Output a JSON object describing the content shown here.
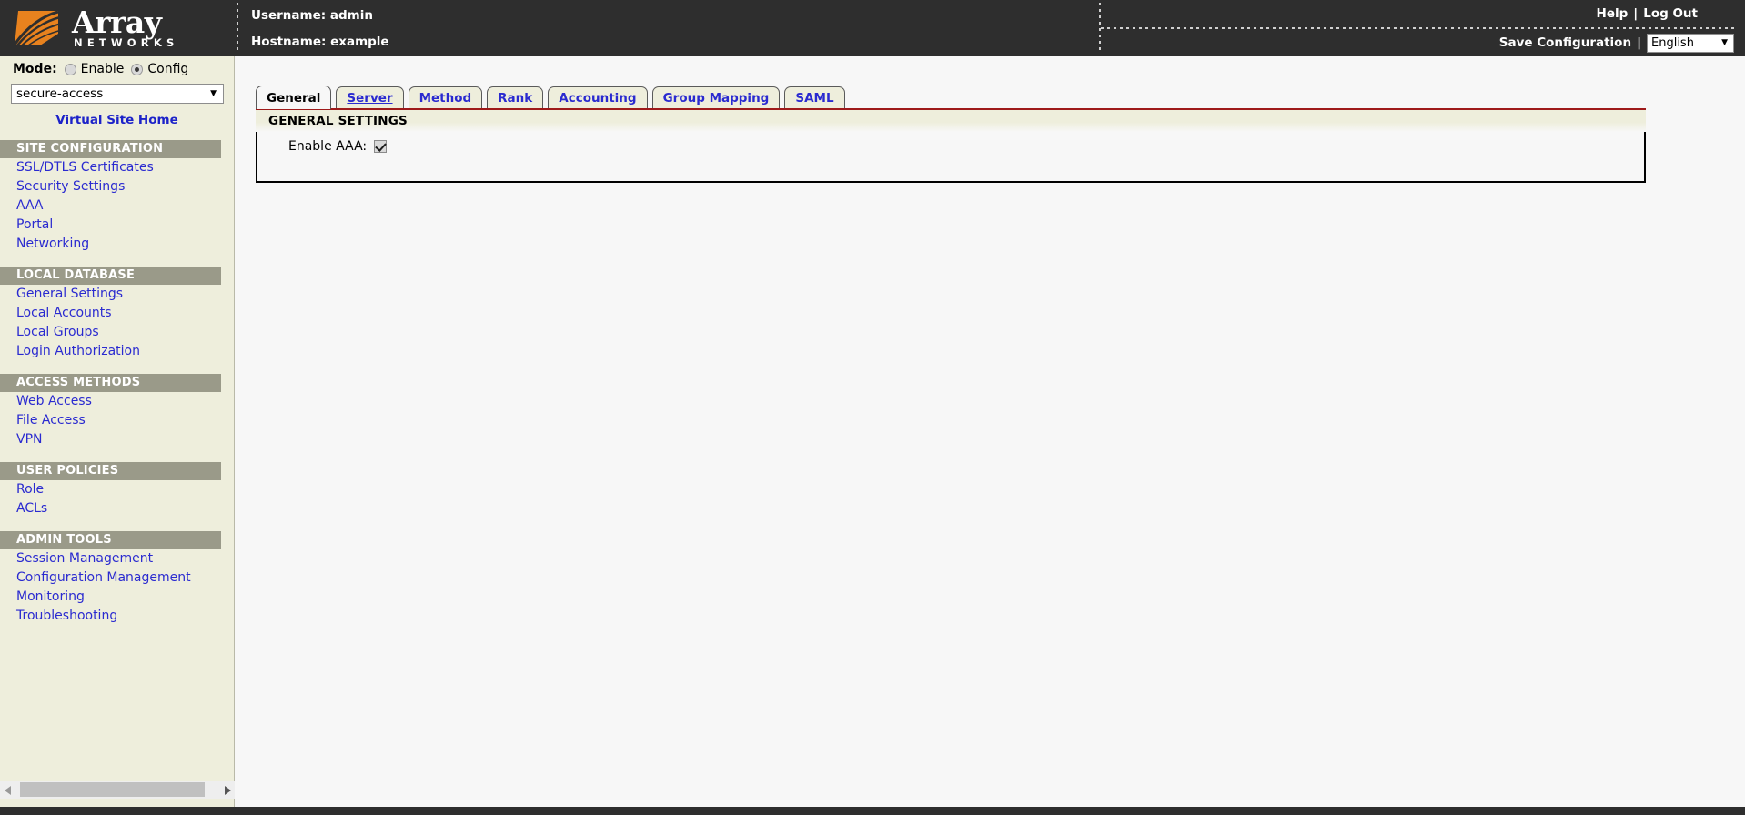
{
  "brand": {
    "name": "Array",
    "subtitle": "NETWORKS",
    "logo_icon": "array-networks-logo",
    "accent_color": "#E8821E",
    "header_bg": "#2E2E2E"
  },
  "header": {
    "username_line": "Username: admin",
    "hostname_line": "Hostname: example",
    "help_label": "Help",
    "separator": "|",
    "logout_label": "Log Out",
    "save_configuration_label": "Save Configuration",
    "language_value": "English",
    "language_options": [
      "English"
    ],
    "caret_icon": "chevron-down-icon"
  },
  "sidebar": {
    "mode_label": "Mode:",
    "mode_options": [
      {
        "label": "Enable",
        "selected": false
      },
      {
        "label": "Config",
        "selected": true
      }
    ],
    "site_select_value": "secure-access",
    "site_select_options": [
      "secure-access"
    ],
    "virtual_site_home_label": "Virtual Site Home",
    "caret_icon": "chevron-down-icon",
    "sections": [
      {
        "header": "SITE CONFIGURATION",
        "items": [
          "SSL/DTLS Certificates",
          "Security Settings",
          "AAA",
          "Portal",
          "Networking"
        ]
      },
      {
        "header": "LOCAL DATABASE",
        "items": [
          "General Settings",
          "Local Accounts",
          "Local Groups",
          "Login Authorization"
        ]
      },
      {
        "header": "ACCESS METHODS",
        "items": [
          "Web Access",
          "File Access",
          "VPN"
        ]
      },
      {
        "header": "USER POLICIES",
        "items": [
          "Role",
          "ACLs"
        ]
      },
      {
        "header": "ADMIN TOOLS",
        "items": [
          "Session Management",
          "Configuration Management",
          "Monitoring",
          "Troubleshooting"
        ]
      }
    ],
    "scrollbar": {
      "left_arrow_icon": "arrow-left-icon",
      "right_arrow_icon": "arrow-right-icon"
    }
  },
  "main": {
    "tabs": [
      {
        "label": "General",
        "active": true,
        "hovered": false
      },
      {
        "label": "Server",
        "active": false,
        "hovered": true
      },
      {
        "label": "Method",
        "active": false,
        "hovered": false
      },
      {
        "label": "Rank",
        "active": false,
        "hovered": false
      },
      {
        "label": "Accounting",
        "active": false,
        "hovered": false
      },
      {
        "label": "Group Mapping",
        "active": false,
        "hovered": false
      },
      {
        "label": "SAML",
        "active": false,
        "hovered": false
      }
    ],
    "panel": {
      "title": "GENERAL SETTINGS",
      "fields": [
        {
          "label": "Enable AAA:",
          "type": "checkbox",
          "checked": true
        }
      ]
    }
  }
}
